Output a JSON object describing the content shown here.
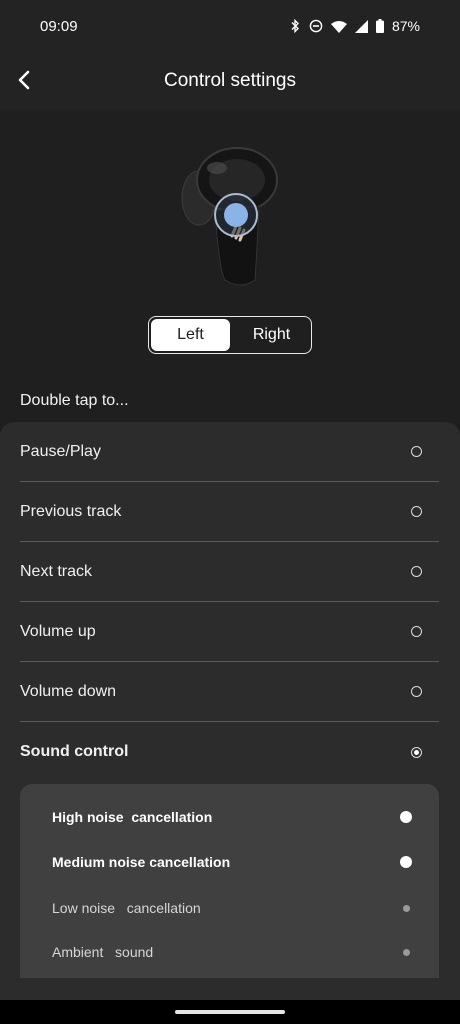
{
  "status_bar": {
    "time": "09:09",
    "battery": "87%",
    "icons": [
      "bluetooth-icon",
      "do-not-disturb-icon",
      "wifi-icon",
      "signal-icon",
      "battery-icon"
    ]
  },
  "header": {
    "title": "Control settings",
    "back_icon": "back-chevron-icon"
  },
  "side_toggle": {
    "left": "Left",
    "right": "Right",
    "selected": "Left"
  },
  "section_label": "Double tap to...",
  "options": [
    {
      "label": "Pause/Play",
      "selected": false
    },
    {
      "label": "Previous track",
      "selected": false
    },
    {
      "label": "Next track",
      "selected": false
    },
    {
      "label": "Volume up",
      "selected": false
    },
    {
      "label": "Volume down",
      "selected": false
    },
    {
      "label": "Sound control",
      "selected": true
    }
  ],
  "sound_control": [
    {
      "label": "High noise  cancellation",
      "enabled": true
    },
    {
      "label": "Medium noise cancellation",
      "enabled": true
    },
    {
      "label": "Low noise   cancellation",
      "enabled": false
    },
    {
      "label": "Ambient   sound",
      "enabled": false
    }
  ],
  "colors": {
    "background": "#1e1e1e",
    "panel": "#2c2c2c",
    "subpanel": "#404040",
    "tap_indicator": "#8ab4e8"
  }
}
